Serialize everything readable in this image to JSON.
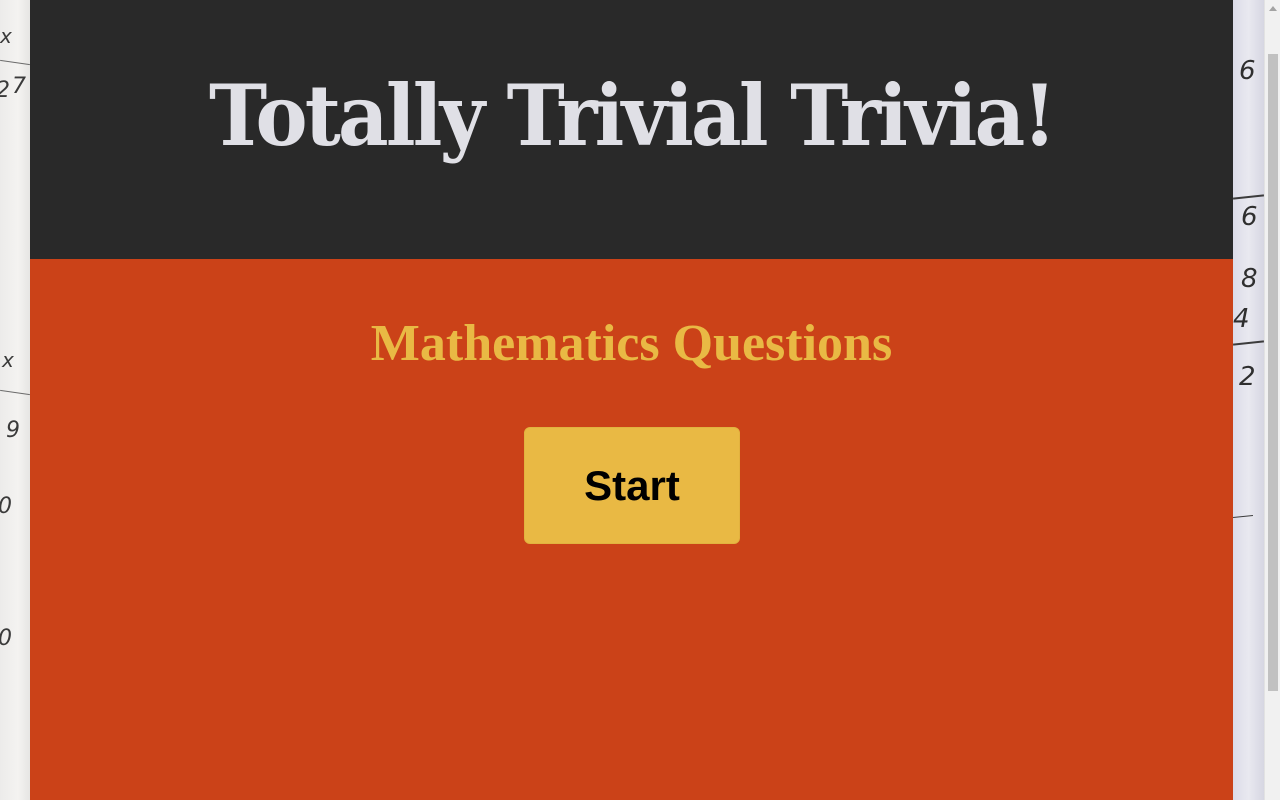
{
  "header": {
    "title": "Totally Trivial Trivia!"
  },
  "main": {
    "category_title": "Mathematics Questions",
    "start_label": "Start"
  },
  "background": {
    "left_marks": [
      "x",
      "2",
      "7",
      "x",
      "9",
      "0",
      "0"
    ],
    "right_marks": [
      "6",
      "6",
      "8",
      "4",
      "2"
    ]
  },
  "colors": {
    "header_bg": "#292929",
    "title_text": "#e0e0e6",
    "main_bg": "#cb4218",
    "accent_yellow": "#e9b944",
    "button_text": "#000000"
  }
}
